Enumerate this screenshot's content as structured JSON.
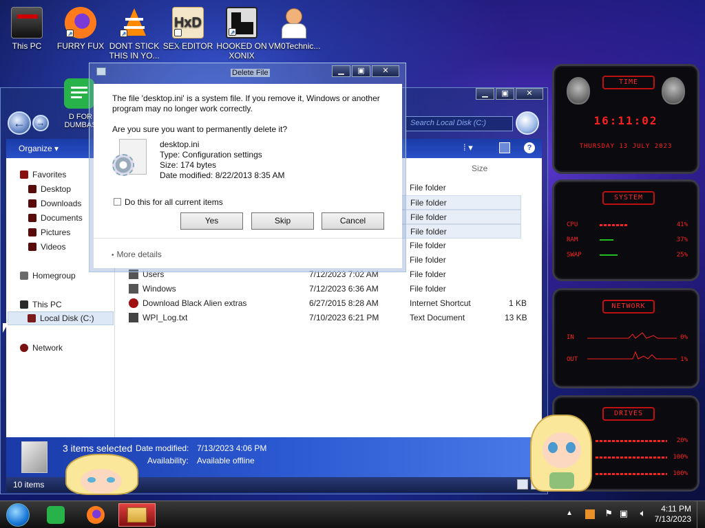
{
  "desktop": {
    "icons": [
      {
        "label": "This PC",
        "icon": "computer-icon"
      },
      {
        "label": "FURRY FUX",
        "icon": "firefox-icon"
      },
      {
        "label": "DONT STICK THIS IN YO...",
        "icon": "vlc-icon"
      },
      {
        "label": "SEX EDITOR",
        "icon": "hxd-icon"
      },
      {
        "label": "HOOKED ON XONIX",
        "icon": "xonix-icon"
      },
      {
        "label": "VM0Technic...",
        "icon": "doctor-icon"
      }
    ],
    "partial_icon_label": "D FOR DUMBAS"
  },
  "explorer": {
    "search_placeholder": "Search Local Disk (C:)",
    "organize_label": "Organize",
    "navpane": {
      "favorites": "Favorites",
      "favorites_items": [
        "Desktop",
        "Downloads",
        "Documents",
        "Pictures",
        "Videos"
      ],
      "homegroup": "Homegroup",
      "this_pc": "This PC",
      "local_disk": "Local Disk (C:)",
      "network": "Network"
    },
    "columns": {
      "size": "Size"
    },
    "files": [
      {
        "name": "",
        "date": "",
        "type": "File folder",
        "size": ""
      },
      {
        "name": "",
        "date": "",
        "type": "File folder",
        "size": ""
      },
      {
        "name": "",
        "date": "",
        "type": "File folder",
        "size": ""
      },
      {
        "name": "",
        "date": "",
        "type": "File folder",
        "size": ""
      },
      {
        "name": "",
        "date": "",
        "type": "File folder",
        "size": ""
      },
      {
        "name": "",
        "date": "",
        "type": "File folder",
        "size": ""
      },
      {
        "name": "Users",
        "date": "7/12/2023 7:02 AM",
        "type": "File folder",
        "size": ""
      },
      {
        "name": "Windows",
        "date": "7/12/2023 6:36 AM",
        "type": "File folder",
        "size": ""
      },
      {
        "name": "Download Black Alien extras",
        "date": "6/27/2015 8:28 AM",
        "type": "Internet Shortcut",
        "size": "1 KB"
      },
      {
        "name": "WPI_Log.txt",
        "date": "7/10/2023 6:21 PM",
        "type": "Text Document",
        "size": "13 KB"
      }
    ],
    "details": {
      "selected": "3 items selected",
      "date_modified_label": "Date modified:",
      "date_modified_value": "7/13/2023 4:06 PM",
      "availability_label": "Availability:",
      "availability_value": "Available offline"
    },
    "status_count": "10 items"
  },
  "dialog": {
    "title": "Delete File",
    "message": "The file 'desktop.ini' is a system file. If you remove it, Windows or another program may no longer work correctly.",
    "message_line1": "The file 'desktop.ini' is a system file. If you remove it, Windows or another",
    "message_line2": "program may no longer work correctly.",
    "question": "Are you sure you want to permanently delete it?",
    "file_name": "desktop.ini",
    "file_type": "Type: Configuration settings",
    "file_size": "Size: 174 bytes",
    "file_date": "Date modified: 8/22/2013 8:35 AM",
    "checkbox_label": "Do this for all current items",
    "yes": "Yes",
    "skip": "Skip",
    "cancel": "Cancel",
    "more_details": "More details"
  },
  "gadgets": {
    "time_header": "TIME",
    "time": "16:11:02",
    "date": "THURSDAY 13 JULY 2023",
    "system_header": "SYSTEM",
    "cpu_label": "CPU",
    "cpu_value": "41%",
    "ram_label": "RAM",
    "ram_value": "37%",
    "swap_label": "SWAP",
    "swap_value": "25%",
    "network_header": "NETWORK",
    "in_label": "IN",
    "in_value": "0%",
    "out_label": "OUT",
    "out_value": "1%",
    "drives_header": "DRIVES",
    "drive_values": [
      "20%",
      "100%",
      "100%"
    ]
  },
  "taskbar": {
    "time": "4:11 PM",
    "date": "7/13/2023"
  },
  "colors": {
    "accent_red": "#ff2020",
    "explorer_blue": "#2a50c8"
  }
}
